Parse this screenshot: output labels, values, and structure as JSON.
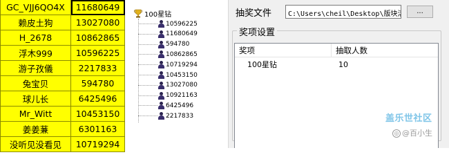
{
  "sheet": {
    "rows": [
      {
        "name": "GC_VJJ6QO4X",
        "value": "11680649"
      },
      {
        "name": "赖皮土狗",
        "value": "13027080"
      },
      {
        "name": "H_2678",
        "value": "10862865"
      },
      {
        "name": "浮木999",
        "value": "10596225"
      },
      {
        "name": "游子孜儀",
        "value": "2217833"
      },
      {
        "name": "兔宝贝",
        "value": "594780"
      },
      {
        "name": "球儿长",
        "value": "6425496"
      },
      {
        "name": "Mr_Witt",
        "value": "10453150"
      },
      {
        "name": "姜姜蒹",
        "value": "6301163"
      },
      {
        "name": "没听见没看见",
        "value": "10719294"
      }
    ]
  },
  "tree": {
    "root_label": "100星钻",
    "root_icon": "trophy-icon",
    "item_icon": "person-icon",
    "items": [
      "10596225",
      "11680649",
      "594780",
      "10862865",
      "10719294",
      "10453150",
      "13027080",
      "10921163",
      "6425496",
      "2217833"
    ]
  },
  "panel": {
    "file_label": "抽奖文件",
    "file_path": "C:\\Users\\cheil\\Desktop\\版块活",
    "browse_label": "...",
    "group_title": "奖项设置",
    "columns": [
      "奖项",
      "抽取人数"
    ],
    "rows": [
      {
        "prize": "100星钻",
        "count": "10"
      }
    ]
  },
  "watermark": {
    "line1": "盖乐世社区",
    "line2": "@百小生",
    "icon_glyph": "◎"
  },
  "colors": {
    "cell_yellow": "#ffff00",
    "panel_bg": "#f0f0f0",
    "watermark_blue": "#7fc5e8"
  }
}
